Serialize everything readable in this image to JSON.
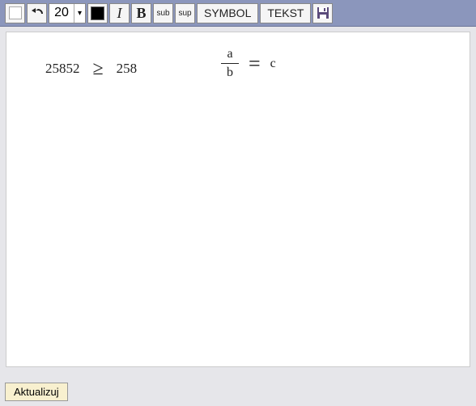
{
  "toolbar": {
    "font_size": "20",
    "italic_label": "I",
    "bold_label": "B",
    "sub_label": "sub",
    "sup_label": "sup",
    "symbol_label": "SYMBOL",
    "text_label": "TEKST"
  },
  "canvas": {
    "expr1": {
      "left": "25852",
      "op": "≥",
      "right": "258"
    },
    "expr2": {
      "numerator": "a",
      "denominator": "b",
      "op": "=",
      "right": "c"
    }
  },
  "footer": {
    "update_label": "Aktualizuj"
  }
}
